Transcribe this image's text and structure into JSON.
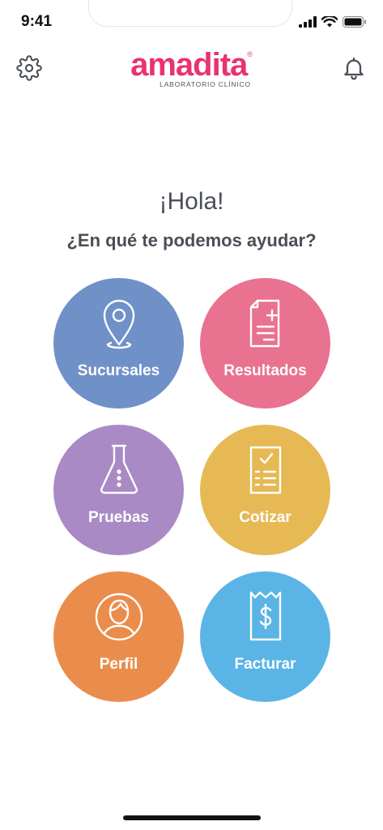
{
  "status_bar": {
    "time": "9:41"
  },
  "header": {
    "logo_text": "amadita",
    "logo_mark": "®",
    "logo_subtitle": "LABORATORIO CLÍNICO",
    "settings_icon": "gear-icon",
    "notifications_icon": "bell-icon"
  },
  "main": {
    "greeting": "¡Hola!",
    "question": "¿En qué te podemos ayudar?",
    "menu": [
      {
        "label": "Sucursales",
        "icon": "location-pin-icon",
        "color": "#7090c8"
      },
      {
        "label": "Resultados",
        "icon": "medical-document-icon",
        "color": "#e8728f"
      },
      {
        "label": "Pruebas",
        "icon": "flask-icon",
        "color": "#a98ac4"
      },
      {
        "label": "Cotizar",
        "icon": "checklist-icon",
        "color": "#e6b955"
      },
      {
        "label": "Perfil",
        "icon": "user-profile-icon",
        "color": "#ea8d4c"
      },
      {
        "label": "Facturar",
        "icon": "receipt-dollar-icon",
        "color": "#5ab4e6"
      }
    ]
  },
  "colors": {
    "brand": "#e8336f",
    "text": "#4a4f57"
  }
}
